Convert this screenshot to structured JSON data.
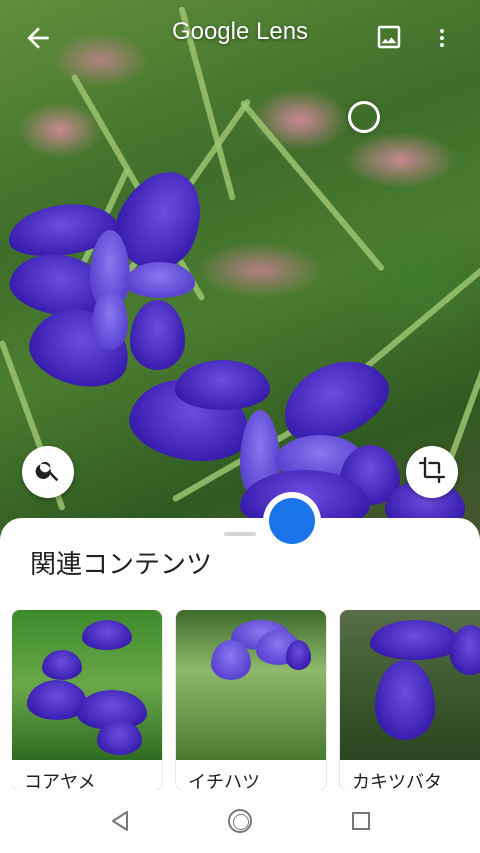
{
  "header": {
    "title": "Google Lens",
    "back_icon": "arrow-back-icon",
    "gallery_icon": "image-icon",
    "more_icon": "more-vert-icon"
  },
  "camera": {
    "search_icon": "search-icon",
    "crop_icon": "crop-icon",
    "shutter_color": "#1a73e8"
  },
  "sheet": {
    "title": "関連コンテンツ",
    "cards": [
      {
        "label": "コアヤメ"
      },
      {
        "label": "イチハツ"
      },
      {
        "label": "カキツバタ"
      }
    ]
  },
  "navbar": {
    "back_icon": "nav-back-icon",
    "home_icon": "nav-home-icon",
    "recent_icon": "nav-recent-icon"
  }
}
